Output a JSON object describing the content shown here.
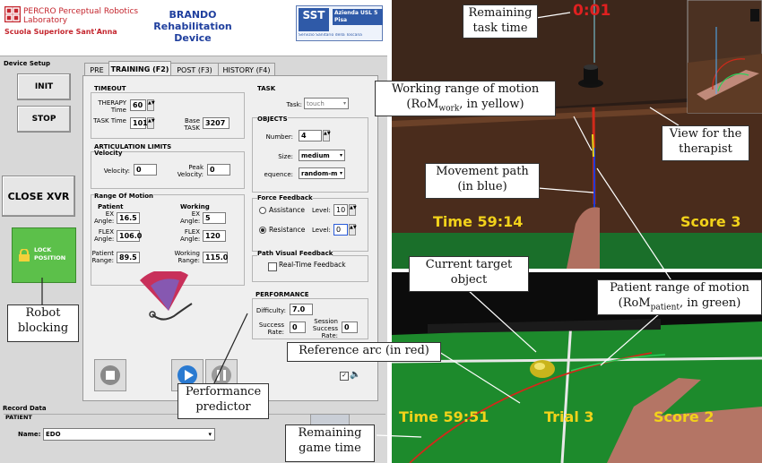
{
  "header": {
    "lab_name": "PERCRO Perceptual Robotics Laboratory",
    "school": "Scuola Superiore Sant'Anna",
    "app_title": "BRANDO Rehabilitation Device",
    "partner": "SST",
    "partner_sub": "Azienda USL 5 Pisa",
    "partner_caption": "Servizio Sanitario della Toscana"
  },
  "sidebar": {
    "section_title": "Device Setup",
    "init_label": "INIT",
    "stop_label": "STOP",
    "close_label": "CLOSE XVR",
    "lock_label": "LOCK POSITION"
  },
  "tabs": [
    "PRE",
    "TRAINING (F2)",
    "POST (F3)",
    "HISTORY (F4)"
  ],
  "timeout": {
    "title": "TIMEOUT",
    "therapy_label": "THERAPY Time",
    "therapy_value": "60",
    "task_label": "TASK Time",
    "task_value": "1012",
    "base_label": "Base TASK",
    "base_value": "3207"
  },
  "articulation": {
    "title": "ARTICULATION LIMITS",
    "velocity_title": "Velocity",
    "velocity_label": "Velocity:",
    "velocity_value": "0",
    "peak_label": "Peak Velocity:",
    "peak_value": "0",
    "rom_title": "Range Of Motion",
    "patient_title": "Patient",
    "working_title": "Working",
    "ex_label": "EX Angle:",
    "flex_label": "FLEX Angle:",
    "patient_ex": "16.5",
    "patient_flex": "106.0",
    "working_ex": "5",
    "working_flex": "120",
    "patient_range_label": "Patient Range:",
    "patient_range": "89.5",
    "working_range_label": "Working Range:",
    "working_range": "115.0"
  },
  "task": {
    "title": "TASK",
    "task_label": "Task:",
    "task_value": "touch",
    "objects_title": "OBJECTS",
    "number_label": "Number:",
    "number_value": "4",
    "size_label": "Size:",
    "size_value": "medium",
    "sequence_label": "equence:",
    "sequence_value": "random-m"
  },
  "force": {
    "title": "Force Feedback",
    "assistance_label": "Assistance",
    "assistance_level_label": "Level:",
    "assistance_level": "10",
    "resistance_label": "Resistance",
    "resistance_level_label": "Level:",
    "resistance_level": "0"
  },
  "path_feedback": {
    "title": "Path Visual Feedback",
    "realtime_label": "Real-Time Feedback"
  },
  "performance": {
    "title": "PERFORMANCE",
    "difficulty_label": "Difficulty:",
    "difficulty_value": "7.0",
    "success_label": "Success Rate:",
    "success_value": "0",
    "session_label": "Session Success Rate:",
    "session_value": "0"
  },
  "record": {
    "title": "Record Data",
    "patient_title": "PATIENT",
    "name_label": "Name:",
    "name_value": "EDO"
  },
  "game_top": {
    "timer": "0:01",
    "time_label": "Time 59:14",
    "score_label": "Score 3"
  },
  "game_bottom": {
    "time_label": "Time 59:51",
    "trial_label": "Trial 3",
    "score_label": "Score 2"
  },
  "callouts": {
    "remaining_task_time": [
      "Remaining",
      "task time"
    ],
    "working_rom": [
      "Working range of motion",
      "(RoM",
      "work",
      ", in yellow)"
    ],
    "view_therapist": [
      "View for the",
      "therapist"
    ],
    "movement_path": [
      "Movement path",
      "(in blue)"
    ],
    "current_target": [
      "Current target",
      "object"
    ],
    "patient_rom": [
      "Patient range of motion",
      "(RoM",
      "patient",
      ", in green)"
    ],
    "robot_blocking": [
      "Robot",
      "blocking"
    ],
    "reference_arc": "Reference arc (in red)",
    "performance_predictor": [
      "Performance",
      "predictor"
    ],
    "remaining_game_time": [
      "Remaining",
      "game time"
    ]
  },
  "colors": {
    "brand_red": "#c4262e",
    "lock_green": "#5cc04a",
    "hud_yellow": "#f2d21a",
    "timer_red": "#e02020",
    "table_green": "#1d8a2c",
    "arc_red": "#d02a1a"
  }
}
